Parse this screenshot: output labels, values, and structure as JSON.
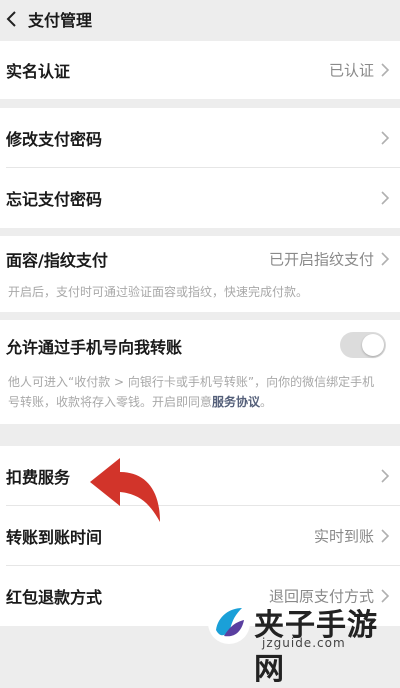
{
  "header": {
    "title": "支付管理",
    "back_icon": "chevron-left-icon"
  },
  "sections": {
    "identity": {
      "label": "实名认证",
      "value": "已认证"
    },
    "password": {
      "change_label": "修改支付密码",
      "forgot_label": "忘记支付密码"
    },
    "biometric": {
      "label": "面容/指纹支付",
      "value": "已开启指纹支付",
      "description": "开启后，支付时可通过验证面容或指纹，快速完成付款。"
    },
    "phone_transfer": {
      "label": "允许通过手机号向我转账",
      "toggle_on": false,
      "description_before": "他人可进入“收付款 > 向银行卡或手机号转账”，向你的微信绑定手机号转账，收款将存入零钱。开启即同意",
      "description_link": "服务协议",
      "description_after": "。"
    },
    "services": {
      "deduction_label": "扣费服务",
      "arrival_label": "转账到账时间",
      "arrival_value": "实时到账",
      "refund_label": "红包退款方式",
      "refund_value": "退回原支付方式"
    }
  },
  "watermark": {
    "title": "夹子手游网",
    "url": "jzguide.com"
  },
  "colors": {
    "background": "#ededed",
    "card": "#ffffff",
    "arrow": "#d2342a",
    "link": "#55607a"
  }
}
